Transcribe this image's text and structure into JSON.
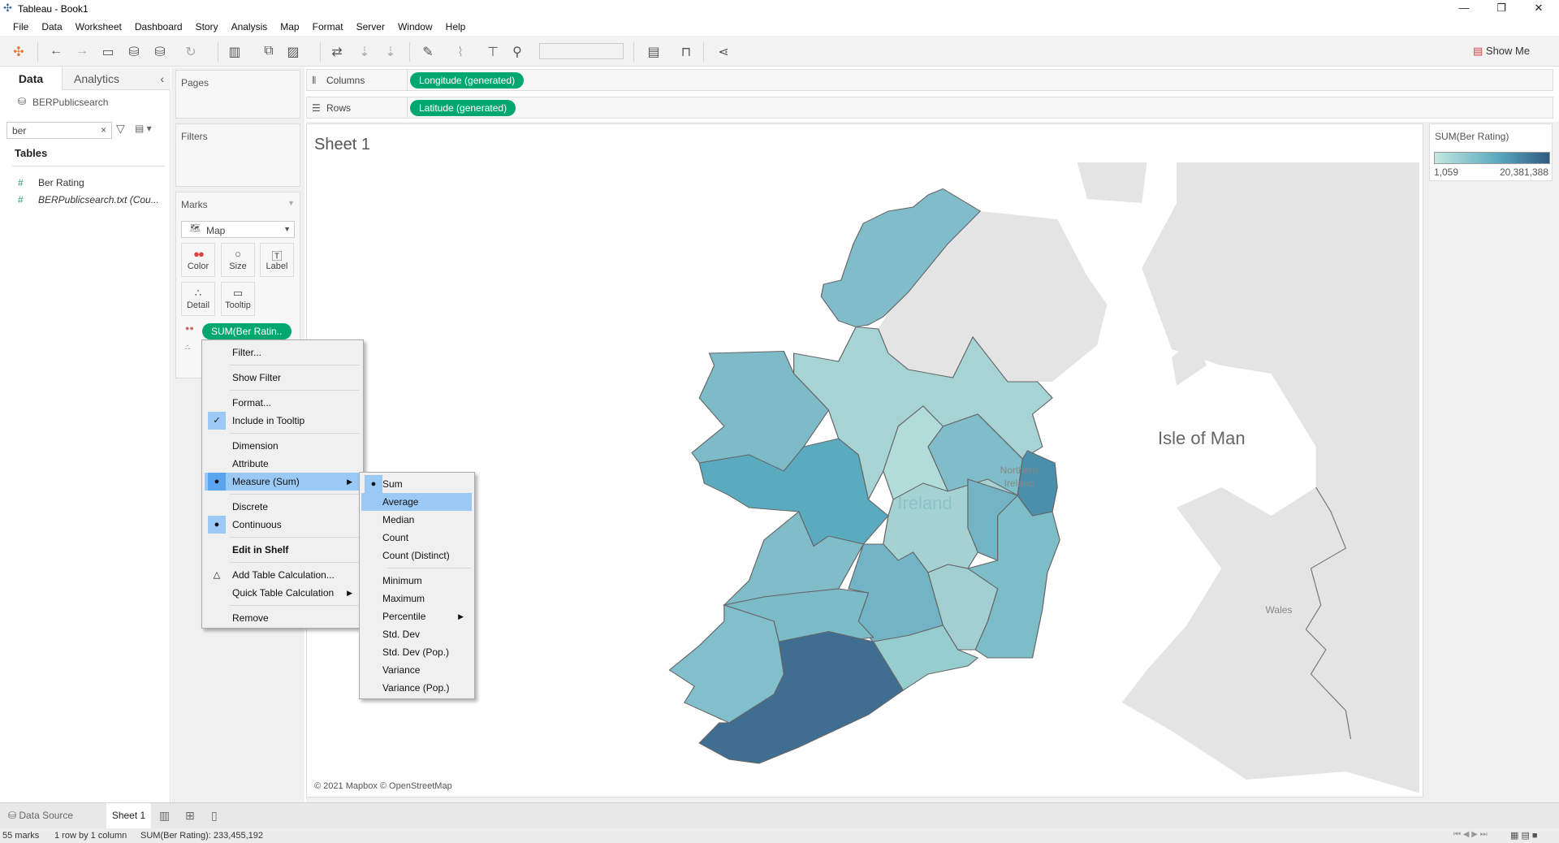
{
  "window": {
    "title": "Tableau - Book1",
    "minimize": "—",
    "restore": "❐",
    "close": "✕"
  },
  "menu": [
    "File",
    "Data",
    "Worksheet",
    "Dashboard",
    "Story",
    "Analysis",
    "Map",
    "Format",
    "Server",
    "Window",
    "Help"
  ],
  "toolbar": {
    "show_me": "Show Me"
  },
  "left_pane": {
    "tabs": [
      "Data",
      "Analytics"
    ],
    "datasource": "BERPublicsearch",
    "search_value": "ber",
    "tables_heading": "Tables",
    "fields": [
      {
        "name": "Ber Rating",
        "italic": false
      },
      {
        "name": "BERPublicsearch.txt (Cou...",
        "italic": true
      }
    ]
  },
  "cards": {
    "pages": "Pages",
    "filters": "Filters",
    "marks": "Marks",
    "mark_type": "Map",
    "mark_buttons": [
      "Color",
      "Size",
      "Label",
      "Detail",
      "Tooltip"
    ],
    "mark_pill": "SUM(Ber Ratin.."
  },
  "shelves": {
    "columns_label": "Columns",
    "columns_pill": "Longitude (generated)",
    "rows_label": "Rows",
    "rows_pill": "Latitude (generated)"
  },
  "sheet": {
    "title": "Sheet 1",
    "map_labels": {
      "ni1": "Northern",
      "ni2": "Ireland",
      "iom": "Isle of Man",
      "ireland": "Ireland",
      "wales": "Wales"
    },
    "attribution": "© 2021 Mapbox © OpenStreetMap"
  },
  "legend": {
    "title": "SUM(Ber Rating)",
    "min": "1,059",
    "max": "20,381,388",
    "color_low": "#c4e6df",
    "color_high": "#2f5b82"
  },
  "context_menu": {
    "items": [
      "Filter...",
      "Show Filter",
      "Format...",
      "Include in Tooltip",
      "Dimension",
      "Attribute",
      "Measure (Sum)",
      "Discrete",
      "Continuous",
      "Edit in Shelf",
      "Add Table Calculation...",
      "Quick Table Calculation",
      "Remove"
    ],
    "submenu": [
      "Sum",
      "Average",
      "Median",
      "Count",
      "Count (Distinct)",
      "Minimum",
      "Maximum",
      "Percentile",
      "Std. Dev",
      "Std. Dev (Pop.)",
      "Variance",
      "Variance (Pop.)"
    ],
    "highlighted": "Measure (Sum)",
    "sub_highlighted": "Average",
    "checked": [
      "Include in Tooltip"
    ],
    "selected": [
      "Measure (Sum)",
      "Continuous",
      "Sum"
    ]
  },
  "bottom": {
    "data_source": "Data Source",
    "sheet_tab": "Sheet 1"
  },
  "status": {
    "marks": "55 marks",
    "dims": "1 row by 1 column",
    "sum": "SUM(Ber Rating): 233,455,192"
  }
}
